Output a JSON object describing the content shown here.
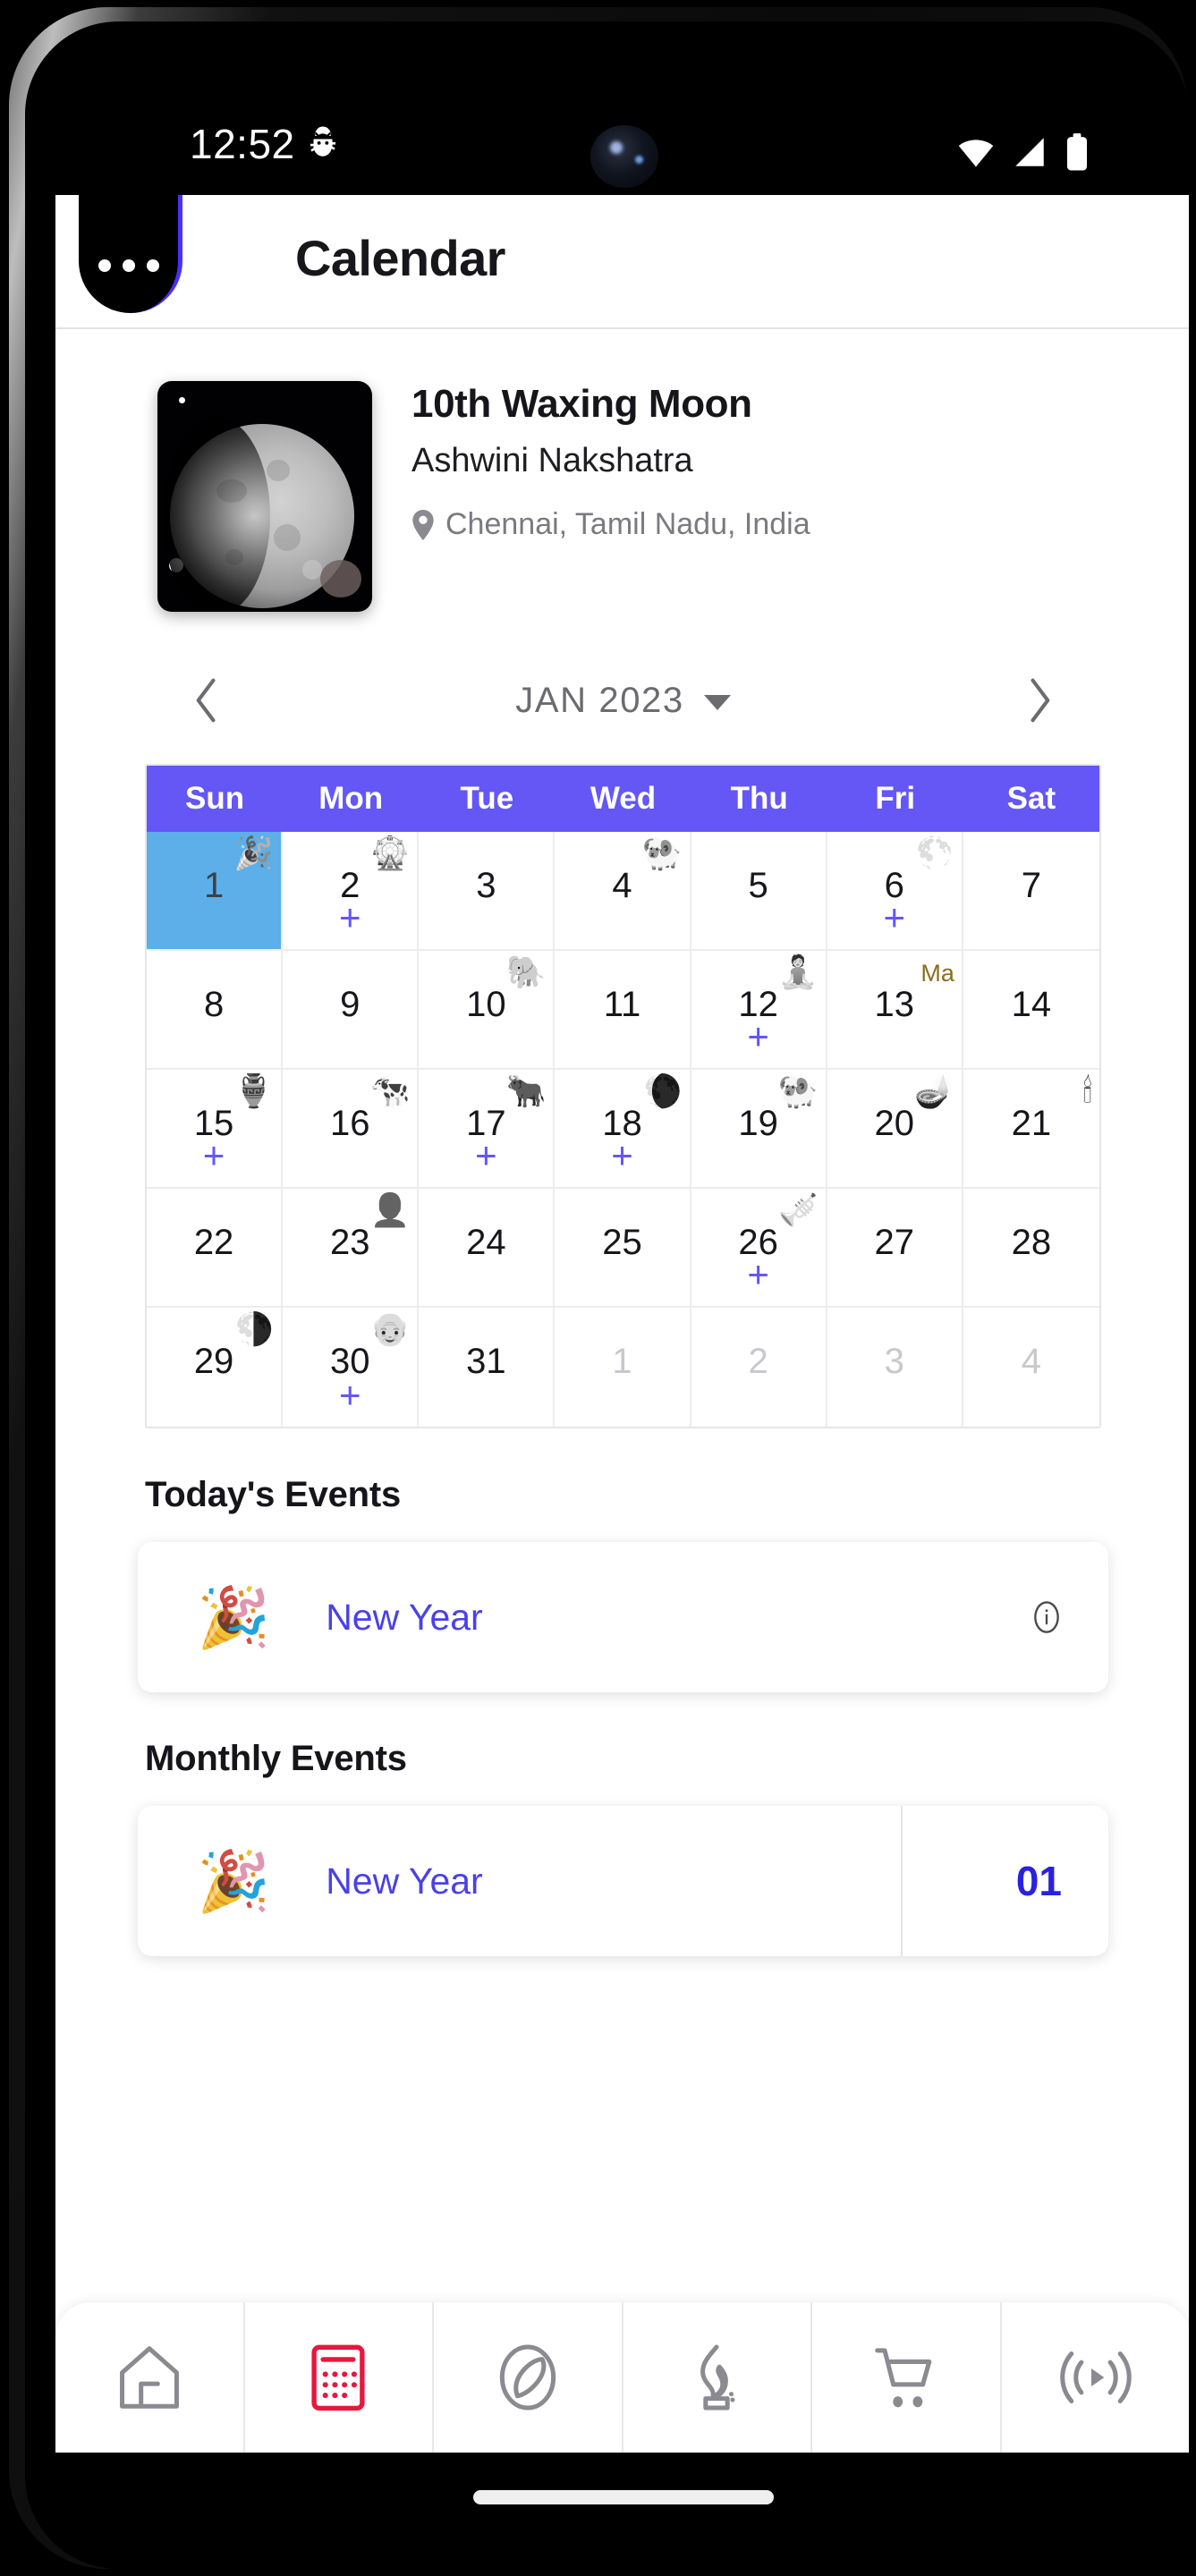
{
  "status_bar": {
    "time": "12:52",
    "icons": [
      "bug-icon",
      "wifi-icon",
      "signal-icon",
      "battery-icon"
    ]
  },
  "app_bar": {
    "menu_icon": "overflow-menu-icon",
    "title": "Calendar"
  },
  "moon_card": {
    "phase_title": "10th Waxing Moon",
    "nakshatra": "Ashwini Nakshatra",
    "location_icon": "map-pin-icon",
    "location": "Chennai, Tamil Nadu, India"
  },
  "month_nav": {
    "prev_icon": "chevron-left-icon",
    "next_icon": "chevron-right-icon",
    "label": "JAN 2023",
    "dropdown_icon": "chevron-down-icon"
  },
  "calendar": {
    "weekdays": [
      "Sun",
      "Mon",
      "Tue",
      "Wed",
      "Thu",
      "Fri",
      "Sat"
    ],
    "header_color": "#6457f5",
    "today_color": "#5cafe8",
    "accent_color": "#6457f5",
    "weeks": [
      [
        {
          "num": "1",
          "today": true,
          "badge": "🎉",
          "plus": false
        },
        {
          "num": "2",
          "today": false,
          "badge": "🎡",
          "plus": true
        },
        {
          "num": "3",
          "today": false,
          "badge": "",
          "plus": false
        },
        {
          "num": "4",
          "today": false,
          "badge": "🐏",
          "plus": false
        },
        {
          "num": "5",
          "today": false,
          "badge": "",
          "plus": false
        },
        {
          "num": "6",
          "today": false,
          "badge": "🌕",
          "plus": true
        },
        {
          "num": "7",
          "today": false,
          "badge": "",
          "plus": false
        }
      ],
      [
        {
          "num": "8",
          "today": false,
          "badge": "",
          "plus": false
        },
        {
          "num": "9",
          "today": false,
          "badge": "",
          "plus": false
        },
        {
          "num": "10",
          "today": false,
          "badge": "🐘",
          "plus": false
        },
        {
          "num": "11",
          "today": false,
          "badge": "",
          "plus": false
        },
        {
          "num": "12",
          "today": false,
          "badge": "🧘",
          "plus": true
        },
        {
          "num": "13",
          "today": false,
          "badge_text": "Ma",
          "plus": false
        },
        {
          "num": "14",
          "today": false,
          "badge": "",
          "plus": false
        }
      ],
      [
        {
          "num": "15",
          "today": false,
          "badge": "🏺",
          "plus": true
        },
        {
          "num": "16",
          "today": false,
          "badge": "🐄",
          "plus": false
        },
        {
          "num": "17",
          "today": false,
          "badge": "🐂",
          "plus": true
        },
        {
          "num": "18",
          "today": false,
          "badge": "🌘",
          "plus": true
        },
        {
          "num": "19",
          "today": false,
          "badge": "🐏",
          "plus": false
        },
        {
          "num": "20",
          "today": false,
          "badge": "🪔",
          "plus": false
        },
        {
          "num": "21",
          "today": false,
          "badge": "🕯",
          "plus": false
        }
      ],
      [
        {
          "num": "22",
          "today": false,
          "badge": "",
          "plus": false
        },
        {
          "num": "23",
          "today": false,
          "badge": "👤",
          "plus": false
        },
        {
          "num": "24",
          "today": false,
          "badge": "",
          "plus": false
        },
        {
          "num": "25",
          "today": false,
          "badge": "",
          "plus": false
        },
        {
          "num": "26",
          "today": false,
          "badge": "🎺",
          "plus": true
        },
        {
          "num": "27",
          "today": false,
          "badge": "",
          "plus": false
        },
        {
          "num": "28",
          "today": false,
          "badge": "",
          "plus": false
        }
      ],
      [
        {
          "num": "29",
          "today": false,
          "badge": "🌗",
          "plus": false
        },
        {
          "num": "30",
          "today": false,
          "badge": "👴",
          "plus": true
        },
        {
          "num": "31",
          "today": false,
          "badge": "",
          "plus": false
        },
        {
          "num": "1",
          "today": false,
          "badge": "",
          "plus": false,
          "other_month": true
        },
        {
          "num": "2",
          "today": false,
          "badge": "",
          "plus": false,
          "other_month": true
        },
        {
          "num": "3",
          "today": false,
          "badge": "",
          "plus": false,
          "other_month": true
        },
        {
          "num": "4",
          "today": false,
          "badge": "",
          "plus": false,
          "other_month": true
        }
      ]
    ]
  },
  "todays_events": {
    "title": "Today's Events",
    "items": [
      {
        "emoji": "🎉",
        "name": "New Year",
        "info_icon": "info-icon"
      }
    ]
  },
  "monthly_events": {
    "title": "Monthly Events",
    "items": [
      {
        "emoji": "🎉",
        "name": "New Year",
        "date": "01"
      }
    ]
  },
  "bottom_nav": {
    "active_color": "#e8173d",
    "inactive_color": "#8a8a90",
    "items": [
      {
        "icon": "home-icon",
        "active": false
      },
      {
        "icon": "calendar-icon",
        "active": true
      },
      {
        "icon": "leaf-icon",
        "active": false
      },
      {
        "icon": "lamp-flame-icon",
        "active": false
      },
      {
        "icon": "cart-icon",
        "active": false
      },
      {
        "icon": "broadcast-icon",
        "active": false
      }
    ]
  }
}
